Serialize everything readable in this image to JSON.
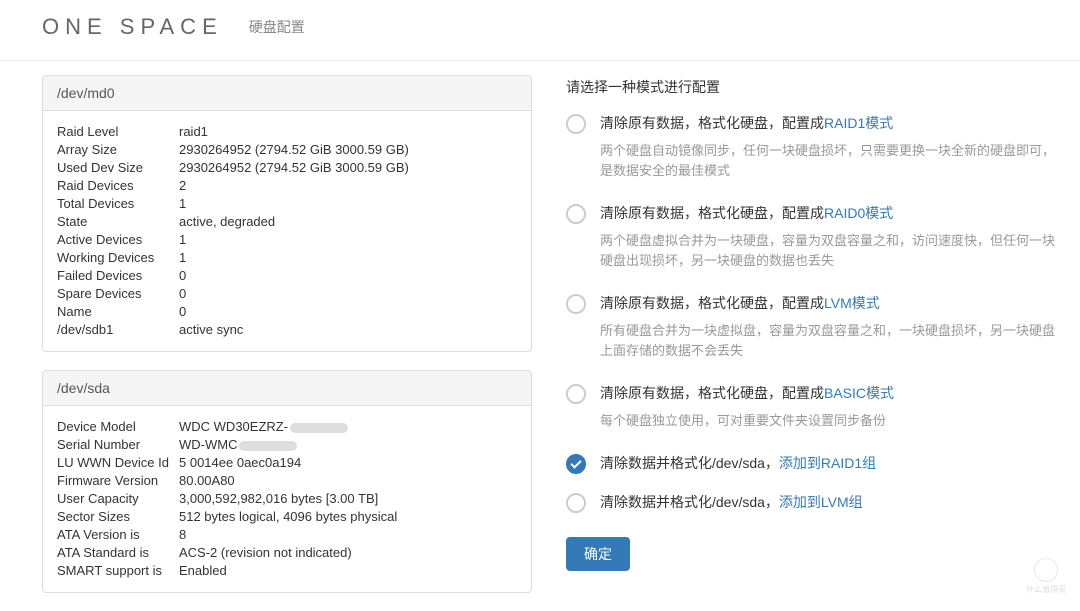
{
  "header": {
    "brand": "ONE SPACE",
    "subtitle": "硬盘配置"
  },
  "panels": [
    {
      "title": "/dev/md0",
      "rows": [
        {
          "k": "Raid Level",
          "v": "raid1"
        },
        {
          "k": "Array Size",
          "v": "2930264952 (2794.52 GiB 3000.59 GB)"
        },
        {
          "k": "Used Dev Size",
          "v": "2930264952 (2794.52 GiB 3000.59 GB)"
        },
        {
          "k": "Raid Devices",
          "v": "2"
        },
        {
          "k": "Total Devices",
          "v": "1"
        },
        {
          "k": "State",
          "v": "active, degraded"
        },
        {
          "k": "Active Devices",
          "v": "1"
        },
        {
          "k": "Working Devices",
          "v": "1"
        },
        {
          "k": "Failed Devices",
          "v": "0"
        },
        {
          "k": "Spare Devices",
          "v": "0"
        },
        {
          "k": "Name",
          "v": "0"
        },
        {
          "k": "/dev/sdb1",
          "v": "active sync"
        }
      ]
    },
    {
      "title": "/dev/sda",
      "rows": [
        {
          "k": "Device Model",
          "v": "WDC WD30EZRZ-",
          "smudge": true
        },
        {
          "k": "Serial Number",
          "v": "WD-WMC",
          "smudge": true
        },
        {
          "k": "LU WWN Device Id",
          "v": "5 0014ee 0aec0a194"
        },
        {
          "k": "Firmware Version",
          "v": "80.00A80"
        },
        {
          "k": "User Capacity",
          "v": "3,000,592,982,016 bytes [3.00 TB]"
        },
        {
          "k": "Sector Sizes",
          "v": "512 bytes logical, 4096 bytes physical"
        },
        {
          "k": "ATA Version is",
          "v": "8"
        },
        {
          "k": "ATA Standard is",
          "v": "ACS-2 (revision not indicated)"
        },
        {
          "k": "SMART support is",
          "v": "Enabled"
        }
      ]
    }
  ],
  "right": {
    "prompt": "请选择一种模式进行配置",
    "options": [
      {
        "pre": "清除原有数据，格式化硬盘，配置成",
        "accent": "RAID1模式",
        "desc": "两个硬盘自动镜像同步，任何一块硬盘损坏，只需要更换一块全新的硬盘即可，是数据安全的最佳模式",
        "selected": false
      },
      {
        "pre": "清除原有数据，格式化硬盘，配置成",
        "accent": "RAID0模式",
        "desc": "两个硬盘虚拟合并为一块硬盘，容量为双盘容量之和，访问速度快，但任何一块硬盘出现损坏，另一块硬盘的数据也丢失",
        "selected": false
      },
      {
        "pre": "清除原有数据，格式化硬盘，配置成",
        "accent": "LVM模式",
        "desc": "所有硬盘合并为一块虚拟盘，容量为双盘容量之和，一块硬盘损坏，另一块硬盘上面存储的数据不会丢失",
        "selected": false
      },
      {
        "pre": "清除原有数据，格式化硬盘，配置成",
        "accent": "BASIC模式",
        "desc": "每个硬盘独立使用，可对重要文件夹设置同步备份",
        "selected": false
      },
      {
        "pre": "清除数据并格式化/dev/sda，",
        "accent": "添加到RAID1组",
        "desc": "",
        "selected": true
      },
      {
        "pre": "清除数据并格式化/dev/sda，",
        "accent": "添加到LVM组",
        "desc": "",
        "selected": false
      }
    ],
    "confirm": "确定"
  },
  "watermark": "什么值得买"
}
